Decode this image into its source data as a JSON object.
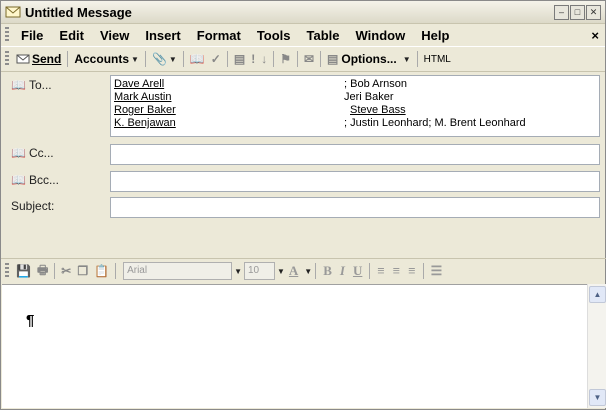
{
  "window": {
    "title": "Untitled Message"
  },
  "menu": [
    "File",
    "Edit",
    "View",
    "Insert",
    "Format",
    "Tools",
    "Table",
    "Window",
    "Help"
  ],
  "menu_close": "×",
  "toolbar": {
    "send": "Send",
    "accounts": "Accounts",
    "options": "Options...",
    "html": "HTML"
  },
  "headers": {
    "to_label": "To...",
    "cc_label": "Cc...",
    "bcc_label": "Bcc...",
    "subject_label": "Subject:",
    "to_col1": [
      "Dave Arell",
      "Mark Austin",
      "Roger Baker",
      "K. Benjawan"
    ],
    "to_col2": [
      "; Bob Arnson",
      "Jeri Baker",
      "Steve Bass",
      "; Justin Leonhard; M. Brent Leonhard"
    ]
  },
  "format": {
    "font": "Arial",
    "size": "10"
  },
  "body": {
    "mark": "¶"
  }
}
